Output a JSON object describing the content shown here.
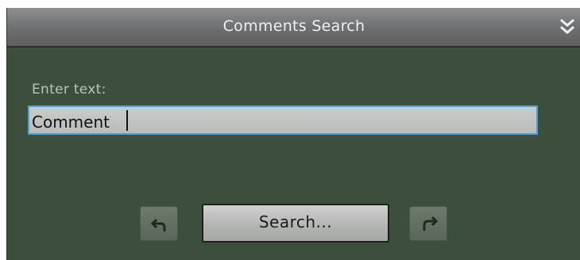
{
  "panel": {
    "title": "Comments Search",
    "collapse_icon": "double-chevron-down-icon"
  },
  "form": {
    "label": "Enter text:",
    "input_value": "Comment"
  },
  "buttons": {
    "search_label": "Search...",
    "back_icon": "undo-arrow-icon",
    "forward_icon": "redo-arrow-icon"
  },
  "colors": {
    "panel_background": "#3c4f3d",
    "titlebar": "#6c6e70",
    "input_focus_border": "#4aa0e0"
  }
}
